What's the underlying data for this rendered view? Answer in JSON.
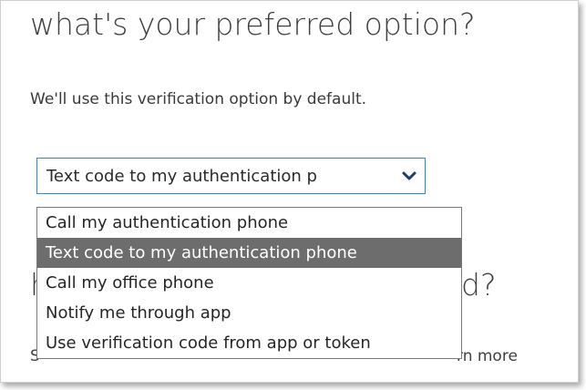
{
  "page": {
    "heading": "what's your preferred option?",
    "description": "We'll use this verification option by default."
  },
  "select": {
    "value": "Text code to my authentication p",
    "chevron_icon": "chevron-down-icon"
  },
  "dropdown": {
    "options": [
      {
        "label": "Call my authentication phone",
        "selected": false
      },
      {
        "label": "Text code to my authentication phone",
        "selected": true
      },
      {
        "label": "Call my office phone",
        "selected": false
      },
      {
        "label": "Notify me through app",
        "selected": false
      },
      {
        "label": "Use verification code from app or token",
        "selected": false
      }
    ]
  },
  "background": {
    "heading_start": "h",
    "heading_end": "d?",
    "line_start": "S",
    "line_end": "rn more"
  },
  "colors": {
    "accent": "#2b88d8",
    "selected_option_bg": "#6d6d6d",
    "text": "#3f3f3f"
  }
}
